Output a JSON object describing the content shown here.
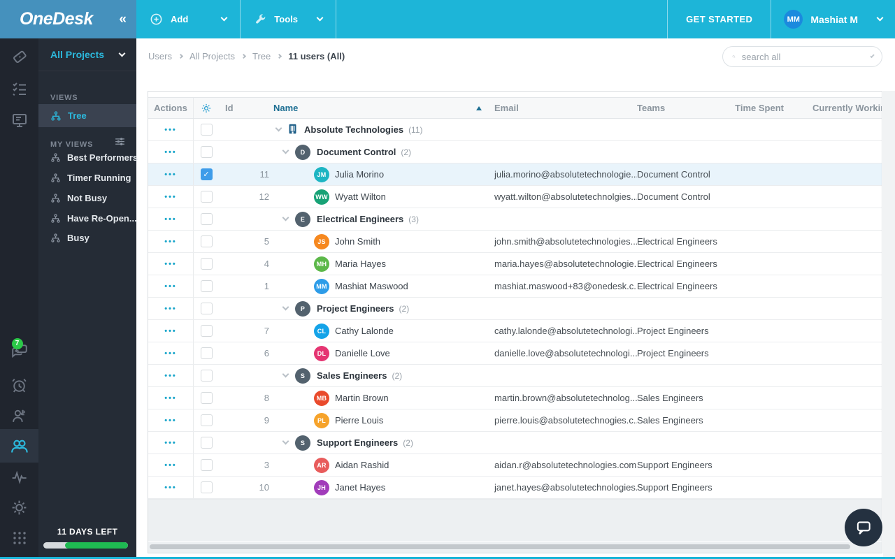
{
  "topbar": {
    "logo": "OneDesk",
    "collapse_glyph": "«",
    "add_label": "Add",
    "tools_label": "Tools",
    "get_started_label": "GET STARTED",
    "user_initials": "MM",
    "user_name": "Mashiat M"
  },
  "sidebar": {
    "project_selector": "All Projects",
    "views_label": "VIEWS",
    "tree_view_label": "Tree",
    "my_views_label": "MY VIEWS",
    "my_views": [
      "Best Performers",
      "Timer Running",
      "Not Busy",
      "Have Re-Open...",
      "Busy"
    ],
    "chat_badge": "7",
    "trial": {
      "days_left_label": "11 DAYS LEFT",
      "progress_pct": 74
    }
  },
  "breadcrumb": {
    "items": [
      "Users",
      "All Projects",
      "Tree"
    ],
    "current": "11 users (All)"
  },
  "search": {
    "placeholder": "search all"
  },
  "table": {
    "columns": {
      "actions": "Actions",
      "id": "Id",
      "name": "Name",
      "email": "Email",
      "teams": "Teams",
      "time_spent": "Time Spent",
      "currently_working": "Currently Workin"
    },
    "sort": {
      "column": "Name",
      "direction": "asc"
    },
    "actions_glyph": "•••",
    "rows": [
      {
        "type": "org",
        "name": "Absolute Technologies",
        "count": "(11)"
      },
      {
        "type": "team",
        "initials": "D",
        "avatar_color": "#53626e",
        "name": "Document Control",
        "count": "(2)"
      },
      {
        "type": "user",
        "id": "11",
        "initials": "JM",
        "avatar_color": "#1db5c3",
        "name": "Julia Morino",
        "email": "julia.morino@absolutetechnologie...",
        "team": "Document Control",
        "checked": true,
        "selected": true
      },
      {
        "type": "user",
        "id": "12",
        "initials": "WW",
        "avatar_color": "#17a276",
        "name": "Wyatt Wilton",
        "email": "wyatt.wilton@absolutetechnolgies...",
        "team": "Document Control"
      },
      {
        "type": "team",
        "initials": "E",
        "avatar_color": "#53626e",
        "name": "Electrical Engineers",
        "count": "(3)"
      },
      {
        "type": "user",
        "id": "5",
        "initials": "JS",
        "avatar_color": "#f6881f",
        "name": "John Smith",
        "email": "john.smith@absolutetechnologies....",
        "team": "Electrical Engineers"
      },
      {
        "type": "user",
        "id": "4",
        "initials": "MH",
        "avatar_color": "#5cb849",
        "name": "Maria Hayes",
        "email": "maria.hayes@absolutetechnologie...",
        "team": "Electrical Engineers"
      },
      {
        "type": "user",
        "id": "1",
        "initials": "MM",
        "avatar_color": "#2d9ce8",
        "name": "Mashiat Maswood",
        "email": "mashiat.maswood+83@onedesk.c...",
        "team": "Electrical Engineers"
      },
      {
        "type": "team",
        "initials": "P",
        "avatar_color": "#53626e",
        "name": "Project Engineers",
        "count": "(2)"
      },
      {
        "type": "user",
        "id": "7",
        "initials": "CL",
        "avatar_color": "#14a3e8",
        "name": "Cathy Lalonde",
        "email": "cathy.lalonde@absolutetechnologi...",
        "team": "Project Engineers"
      },
      {
        "type": "user",
        "id": "6",
        "initials": "DL",
        "avatar_color": "#e53572",
        "name": "Danielle Love",
        "email": "danielle.love@absolutetechnologi...",
        "team": "Project Engineers"
      },
      {
        "type": "team",
        "initials": "S",
        "avatar_color": "#53626e",
        "name": "Sales Engineers",
        "count": "(2)"
      },
      {
        "type": "user",
        "id": "8",
        "initials": "MB",
        "avatar_color": "#e94a2c",
        "name": "Martin Brown",
        "email": "martin.brown@absolutetechnolog...",
        "team": "Sales Engineers"
      },
      {
        "type": "user",
        "id": "9",
        "initials": "PL",
        "avatar_color": "#f6a32b",
        "name": "Pierre Louis",
        "email": "pierre.louis@absolutetechnogies.c...",
        "team": "Sales Engineers"
      },
      {
        "type": "team",
        "initials": "S",
        "avatar_color": "#53626e",
        "name": "Support Engineers",
        "count": "(2)"
      },
      {
        "type": "user",
        "id": "3",
        "initials": "AR",
        "avatar_color": "#e85c5c",
        "name": "Aidan Rashid",
        "email": "aidan.r@absolutetechnologies.com",
        "team": "Support Engineers"
      },
      {
        "type": "user",
        "id": "10",
        "initials": "JH",
        "avatar_color": "#a13cba",
        "name": "Janet Hayes",
        "email": "janet.hayes@absolutetechnologies...",
        "team": "Support Engineers"
      }
    ]
  },
  "colors": {
    "topbar": "#1db5d8",
    "logo_bg": "#4591bd",
    "sidebar_bg": "#252c36",
    "accent_cyan": "#2cb8dc",
    "selected_row": "#e9f4fb",
    "checkbox_checked": "#3e9ce9",
    "trial_green": "#1fba52",
    "badge_green": "#2bc948",
    "org_icon_blue": "#1d5e87"
  }
}
